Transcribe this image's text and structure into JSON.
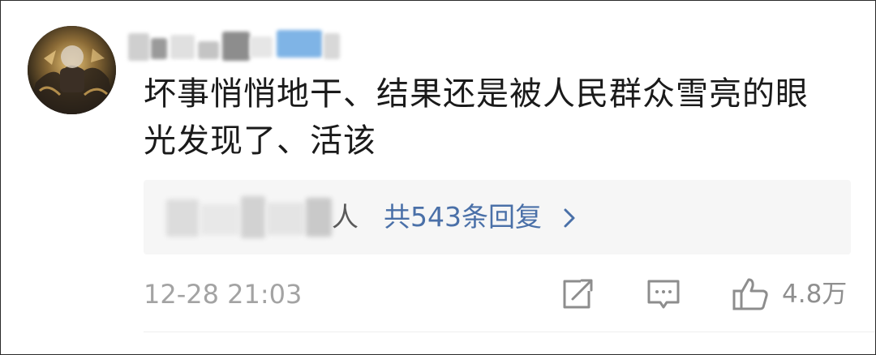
{
  "comment": {
    "avatar_icon": "avatar-image",
    "username": "",
    "username_blurred": true,
    "text": "坏事悄悄地干、结果还是被人民群众雪亮的眼光发现了、活该"
  },
  "replies": {
    "replier_names_blurred": true,
    "suffix": "等人",
    "suffix_visible": "人",
    "count_label": "共543条回复",
    "chevron_icon": "chevron-right-icon"
  },
  "footer": {
    "timestamp": "12-28 21:03",
    "actions": [
      {
        "name": "share",
        "icon": "share-icon"
      },
      {
        "name": "reply",
        "icon": "comment-icon"
      },
      {
        "name": "like",
        "icon": "thumbs-up-icon",
        "count": "4.8万"
      }
    ]
  },
  "colors": {
    "text": "#1a1a1a",
    "link": "#4a70a8",
    "muted": "#a3a3a3",
    "reply_panel_bg": "#f6f6f6",
    "badge": "#7fb4e6"
  }
}
